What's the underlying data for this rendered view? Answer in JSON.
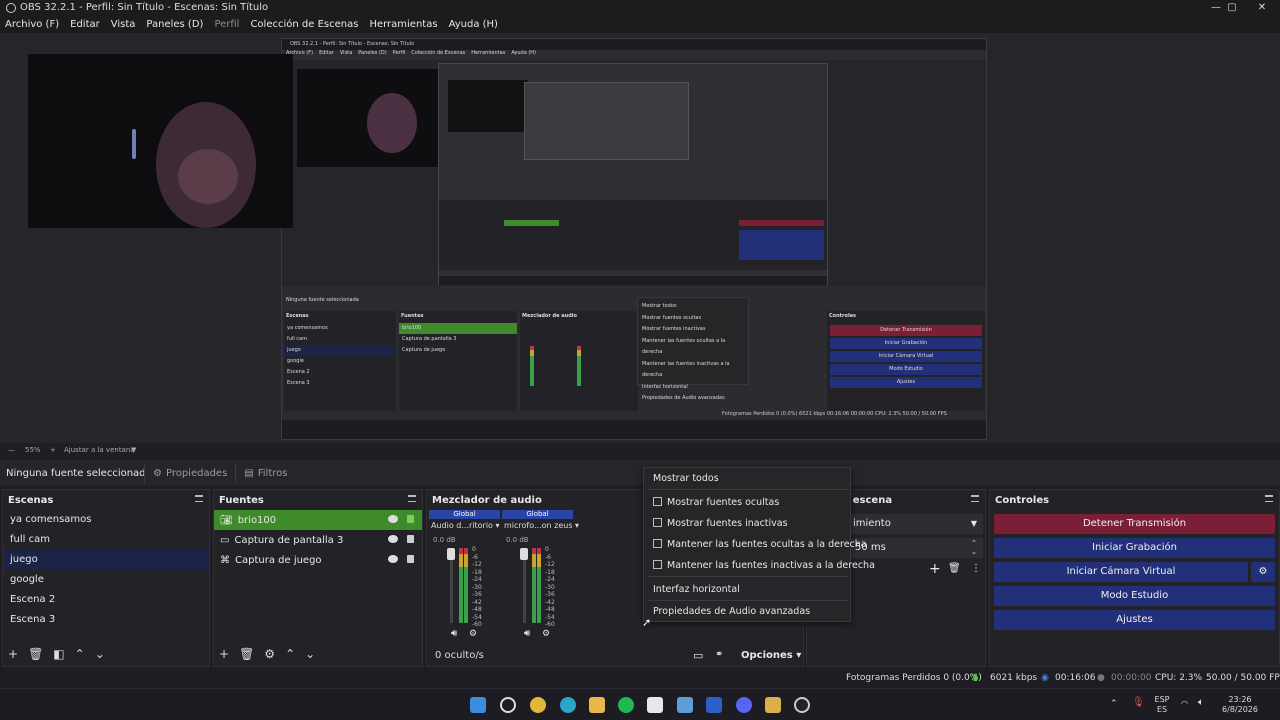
{
  "window": {
    "title": "OBS 32.2.1 - Perfil: Sin Título - Escenas: Sin Título"
  },
  "menu": [
    {
      "label": "Archivo (F)",
      "dim": false
    },
    {
      "label": "Editar",
      "dim": false
    },
    {
      "label": "Vista",
      "dim": false
    },
    {
      "label": "Paneles (D)",
      "dim": false
    },
    {
      "label": "Perfil",
      "dim": true
    },
    {
      "label": "Colección de Escenas",
      "dim": false
    },
    {
      "label": "Herramientas",
      "dim": false
    },
    {
      "label": "Ayuda (H)",
      "dim": false
    }
  ],
  "zoom": {
    "value": "55%",
    "fit": "Ajustar a la ventana"
  },
  "source_toolbar": {
    "no_source": "Ninguna fuente seleccionada",
    "properties": "Propiedades",
    "filters": "Filtros"
  },
  "scenes": {
    "title": "Escenas",
    "items": [
      "ya comensamos",
      "full cam",
      "juego",
      "google",
      "Escena 2",
      "Escena 3"
    ],
    "selected": 2
  },
  "sources": {
    "title": "Fuentes",
    "items": [
      {
        "name": "brio100",
        "icon": "camera-icon"
      },
      {
        "name": "Captura de pantalla 3",
        "icon": "monitor-icon"
      },
      {
        "name": "Captura de juego",
        "icon": "gamepad-icon"
      }
    ],
    "selected": 0
  },
  "mixer": {
    "title": "Mezclador de audio",
    "channels": [
      {
        "head": "Global",
        "name": "Audio d...ritorio",
        "db": "0.0 dB"
      },
      {
        "head": "Global",
        "name": "microfo...on zeus",
        "db": "0.0 dB"
      }
    ],
    "scale": [
      "0",
      "-6",
      "-12",
      "-18",
      "-24",
      "-30",
      "-36",
      "-42",
      "-48",
      "-54",
      "-60"
    ],
    "hidden": "0 oculto/s",
    "options": "Opciones"
  },
  "transitions": {
    "title": "nes de escena",
    "type": "imiento",
    "duration": "50 ms"
  },
  "controls": {
    "title": "Controles",
    "buttons": [
      "Detener Transmisión",
      "Iniciar Grabación",
      "Iniciar Cámara Virtual",
      "Modo Estudio",
      "Ajustes"
    ]
  },
  "context_menu": {
    "show_all": "Mostrar todos",
    "checks": [
      "Mostrar fuentes ocultas",
      "Mostrar fuentes inactivas",
      "Mantener las fuentes ocultas a la derecha",
      "Mantener las fuentes inactivas a la derecha"
    ],
    "horizontal": "Interfaz horizontal",
    "advanced": "Propiedades de Audio avanzadas"
  },
  "status": {
    "dropped": "Fotogramas Perdidos 0 (0.0%)",
    "bitrate": "6021 kbps",
    "stream_time": "00:16:06",
    "rec_time": "00:00:00",
    "cpu": "CPU: 2.3%",
    "fps": "50.00 / 50.00 FPS"
  },
  "taskbar": {
    "lang": "ESP",
    "region": "ES",
    "time": "23:26",
    "date": "6/8/2026"
  },
  "nested": {
    "title": "OBS 32.2.1 - Perfil: Sin Título - Escenas: Sin Título",
    "menu": [
      "Archivo (F)",
      "Editar",
      "Vista",
      "Paneles (D)",
      "Perfil",
      "Colección de Escenas",
      "Herramientas",
      "Ayuda (H)"
    ],
    "no_source": "Ninguna fuente seleccionada",
    "scenes": [
      "ya comensamos",
      "full cam",
      "juego",
      "google",
      "Escena 2",
      "Escena 3"
    ],
    "sources": [
      "brio100",
      "Captura de pantalla 3",
      "Captura de juego"
    ],
    "menu_items": [
      "Mostrar todos",
      "Mostrar fuentes ocultas",
      "Mostrar fuentes inactivas",
      "Mantener las fuentes ocultas a la derecha",
      "Mantener las fuentes inactivas a la derecha",
      "Interfaz horizontal",
      "Propiedades de Audio avanzadas"
    ],
    "controls": [
      "Detener Transmisión",
      "Iniciar Grabación",
      "Iniciar Cámara Virtual",
      "Modo Estudio",
      "Ajustes"
    ],
    "status": "Fotogramas Perdidos 0 (0.0%)   6021 kbps   00:16:06   00:00:00   CPU: 2.3%   50.00 / 50.00 FPS"
  }
}
